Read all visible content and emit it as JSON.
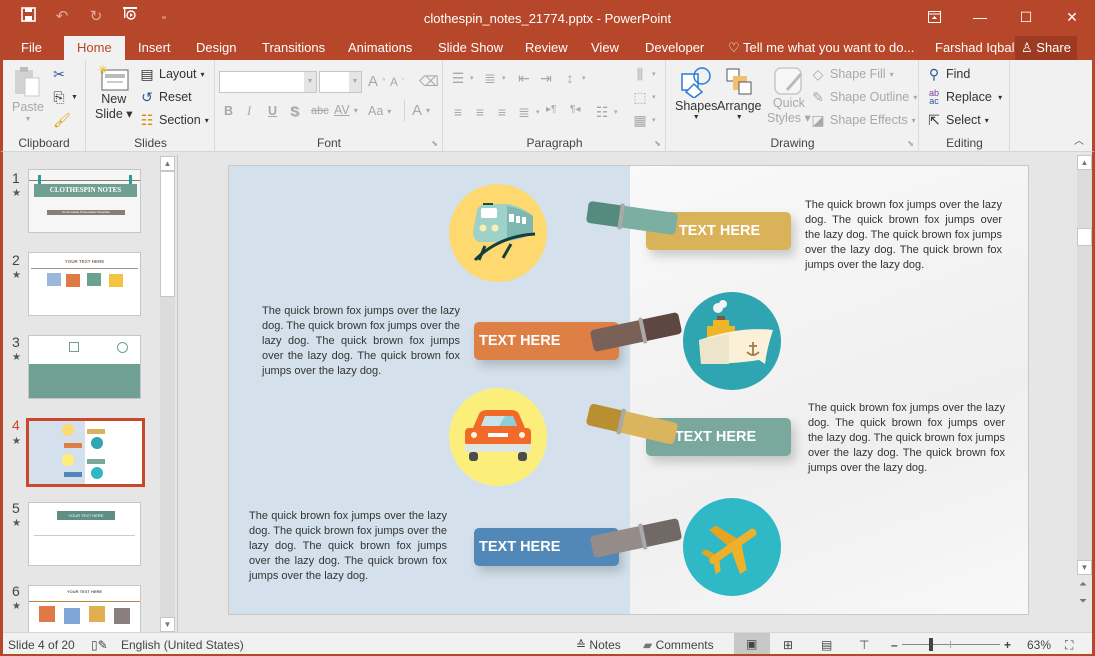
{
  "window": {
    "title": "clothespin_notes_21774.pptx - PowerPoint",
    "controls": {
      "restore_ribbon": "ribbon-display-icon",
      "minimize": "—",
      "maximize": "☐",
      "close": "✕"
    }
  },
  "qat": {
    "save": "save-icon",
    "undo": "undo-icon",
    "redo": "redo-icon",
    "present": "present-from-start-icon",
    "customize": "customize-qat-icon"
  },
  "tabs": [
    "File",
    "Home",
    "Insert",
    "Design",
    "Transitions",
    "Animations",
    "Slide Show",
    "Review",
    "View",
    "Developer"
  ],
  "active_tab": "Home",
  "tell_me": "Tell me what you want to do...",
  "user": "Farshad Iqbal",
  "share": "Share",
  "ribbon": {
    "clipboard": {
      "label": "Clipboard",
      "paste": "Paste"
    },
    "slides": {
      "label": "Slides",
      "new_slide_1": "New",
      "new_slide_2": "Slide",
      "layout": "Layout",
      "reset": "Reset",
      "section": "Section"
    },
    "font": {
      "label": "Font",
      "font_name": "",
      "font_size": "",
      "bold": "B",
      "italic": "I",
      "underline": "U",
      "shadow": "S",
      "strike": "abc",
      "spacing": "AV",
      "case": "Aa",
      "grow": "A",
      "shrink": "A",
      "color": "A"
    },
    "paragraph": {
      "label": "Paragraph"
    },
    "drawing": {
      "label": "Drawing",
      "shapes": "Shapes",
      "arrange": "Arrange",
      "quick_styles_1": "Quick",
      "quick_styles_2": "Styles",
      "shape_fill": "Shape Fill",
      "shape_outline": "Shape Outline",
      "shape_effects": "Shape Effects"
    },
    "editing": {
      "label": "Editing",
      "find": "Find",
      "replace": "Replace",
      "select": "Select"
    }
  },
  "thumbnails": [
    {
      "num": "1",
      "title": "CLOTHESPIN NOTES",
      "subtitle": "An Animated Presentation Template"
    },
    {
      "num": "2",
      "title": "YOUR TEXT HERE"
    },
    {
      "num": "3",
      "title": ""
    },
    {
      "num": "4",
      "title": "",
      "selected": true
    },
    {
      "num": "5",
      "title": "YOUR TEXT HERE"
    },
    {
      "num": "6",
      "title": "YOUR TEXT HERE"
    }
  ],
  "slide": {
    "items": [
      {
        "label": "TEXT HERE",
        "icon": "train-icon",
        "label_color": "#d9b25a",
        "pin_color": "#6ea79a",
        "circle_color": "#fdd970",
        "text": "The quick brown fox jumps over the lazy dog. The quick brown fox jumps over the lazy dog. The quick brown fox jumps over the lazy dog. The quick brown fox jumps over the lazy dog."
      },
      {
        "label": "TEXT HERE",
        "icon": "ship-icon",
        "label_color": "#de7f45",
        "pin_color": "#6b5148",
        "circle_color": "#2ea5b0",
        "text": "The quick brown fox jumps over the lazy dog. The quick brown fox jumps over the lazy dog. The quick brown fox jumps over the lazy dog. The quick brown fox jumps over the lazy dog."
      },
      {
        "label": "TEXT HERE",
        "icon": "car-icon",
        "label_color": "#7aa89c",
        "pin_color": "#c9a04a",
        "circle_color": "#fcee7b",
        "text": "The quick brown fox jumps over the lazy dog. The quick brown fox jumps over the lazy dog. The quick brown fox jumps over the lazy dog. The quick brown fox jumps over the lazy dog."
      },
      {
        "label": "TEXT HERE",
        "icon": "airplane-icon",
        "label_color": "#5288b8",
        "pin_color": "#857b79",
        "circle_color": "#2fb8c6",
        "text": "The quick brown fox jumps over the lazy dog. The quick brown fox jumps over the lazy dog. The quick brown fox jumps over the lazy dog. The quick brown fox jumps over the lazy dog."
      }
    ]
  },
  "status": {
    "slide_info": "Slide 4 of 20",
    "language": "English (United States)",
    "notes": "Notes",
    "comments": "Comments",
    "zoom_percent": "63%",
    "zoom_level": 63
  }
}
